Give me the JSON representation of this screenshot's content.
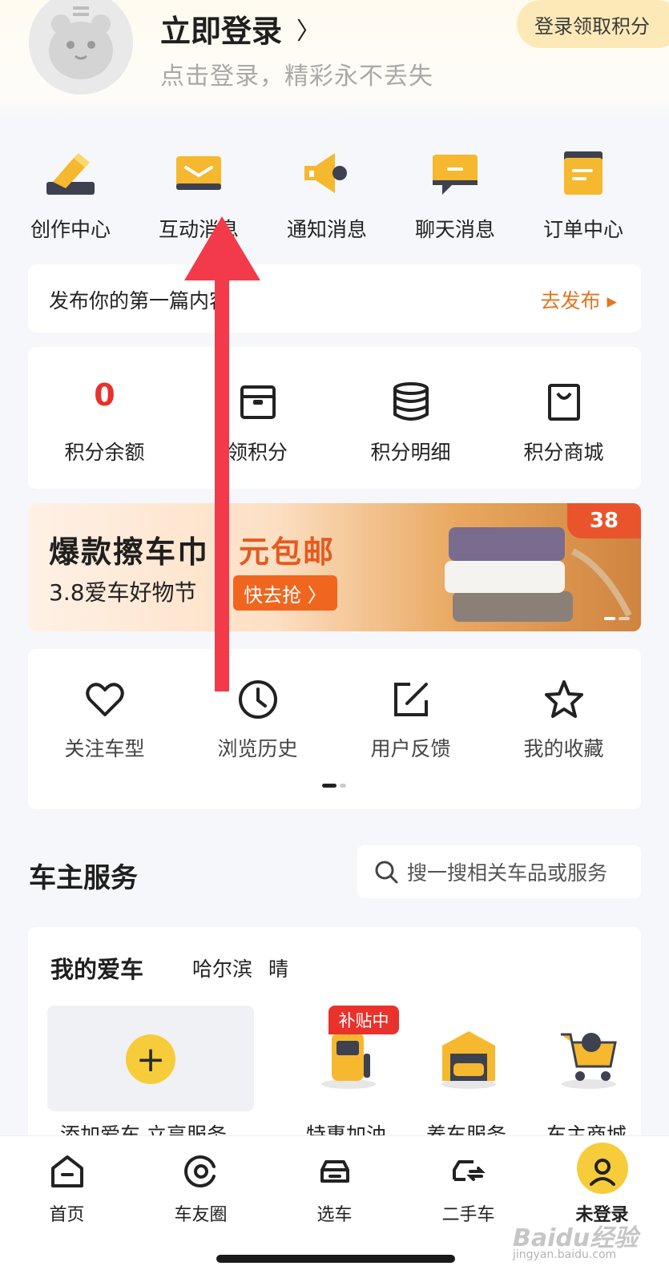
{
  "header": {
    "login_title": "立即登录",
    "login_subtitle": "点击登录，精彩永不丢失",
    "points_pill": "登录领取积分"
  },
  "quick_actions": [
    {
      "label": "创作中心",
      "icon": "pencil-icon"
    },
    {
      "label": "互动消息",
      "icon": "envelope-icon"
    },
    {
      "label": "通知消息",
      "icon": "megaphone-icon"
    },
    {
      "label": "聊天消息",
      "icon": "chat-bubble-icon"
    },
    {
      "label": "订单中心",
      "icon": "order-list-icon"
    }
  ],
  "publish": {
    "text": "发布你的第一篇内容",
    "action": "去发布 ▸"
  },
  "points": {
    "balance_value": "0",
    "balance_label": "积分余额",
    "claim_label": "领积分",
    "detail_label": "积分明细",
    "mall_label": "积分商城"
  },
  "banner": {
    "headline": "爆款擦车巾",
    "headline_accent": "元包邮",
    "subline": "3.8爱车好物节",
    "cta": "快去抢 〉",
    "tag": "38"
  },
  "tools": [
    {
      "label": "关注车型",
      "icon": "heart-icon"
    },
    {
      "label": "浏览历史",
      "icon": "clock-icon"
    },
    {
      "label": "用户反馈",
      "icon": "edit-icon"
    },
    {
      "label": "我的收藏",
      "icon": "star-icon"
    }
  ],
  "service": {
    "title": "车主服务",
    "search_placeholder": "搜一搜相关车品或服务"
  },
  "my_car": {
    "title": "我的爱车",
    "city": "哈尔滨",
    "weather": "晴",
    "add_label": "添加爱车 立享服务",
    "subsidy_badge": "补贴中",
    "services": [
      {
        "label": "特惠加油",
        "icon": "fuel-pump-icon"
      },
      {
        "label": "养车服务",
        "icon": "car-garage-icon"
      },
      {
        "label": "车主商城",
        "icon": "shopping-cart-icon"
      }
    ]
  },
  "tabbar": [
    {
      "label": "首页",
      "icon": "home-icon"
    },
    {
      "label": "车友圈",
      "icon": "circle-icon"
    },
    {
      "label": "选车",
      "icon": "car-icon"
    },
    {
      "label": "二手车",
      "icon": "used-car-icon"
    },
    {
      "label": "未登录",
      "icon": "user-icon",
      "active": true
    }
  ],
  "watermark": {
    "brand": "Baidu经验",
    "url": "jingyan.baidu.com"
  },
  "colors": {
    "accent_yellow": "#f7cc3a",
    "accent_red": "#e8312b",
    "accent_orange": "#e2751d",
    "annotation_arrow": "#f33a4a"
  }
}
